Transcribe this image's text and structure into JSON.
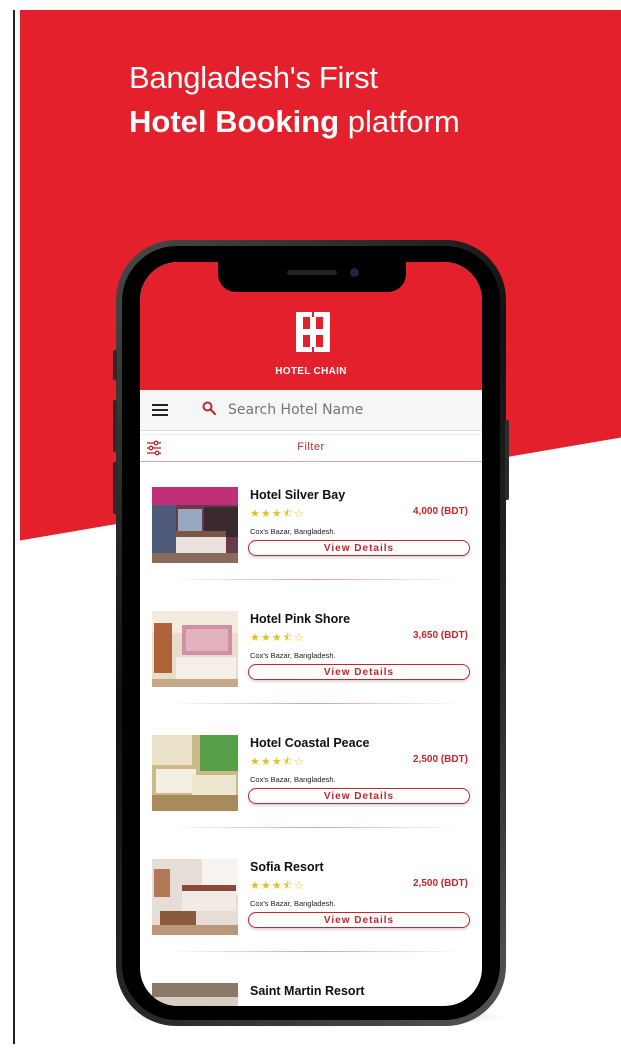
{
  "headline": {
    "line1": "Bangladesh's First",
    "line2_bold": "Hotel Booking",
    "line2_rest": " platform"
  },
  "app": {
    "brand": "HOTEL CHAIN",
    "search": {
      "placeholder": "Search Hotel Name"
    },
    "filter_label": "Filter",
    "view_details_label": "View Details",
    "hotels": [
      {
        "name": "Hotel Silver Bay",
        "rating": 3.5,
        "stars": "★★★⯪☆",
        "price": "4,000 (BDT)",
        "location": "Cox's Bazar, Bangladesh."
      },
      {
        "name": "Hotel Pink Shore",
        "rating": 3.5,
        "stars": "★★★⯪☆",
        "price": "3,650 (BDT)",
        "location": "Cox's Bazar, Bangladesh."
      },
      {
        "name": "Hotel Coastal Peace",
        "rating": 3.5,
        "stars": "★★★⯪☆",
        "price": "2,500 (BDT)",
        "location": "Cox's Bazar, Bangladesh."
      },
      {
        "name": "Sofia Resort",
        "rating": 3.5,
        "stars": "★★★⯪☆",
        "price": "2,500 (BDT)",
        "location": "Cox's Bazar, Bangladesh."
      },
      {
        "name": "Saint Martin Resort"
      }
    ]
  },
  "colors": {
    "brand_red": "#e3202b",
    "accent_red": "#c1272d",
    "star_yellow": "#e5c023"
  }
}
